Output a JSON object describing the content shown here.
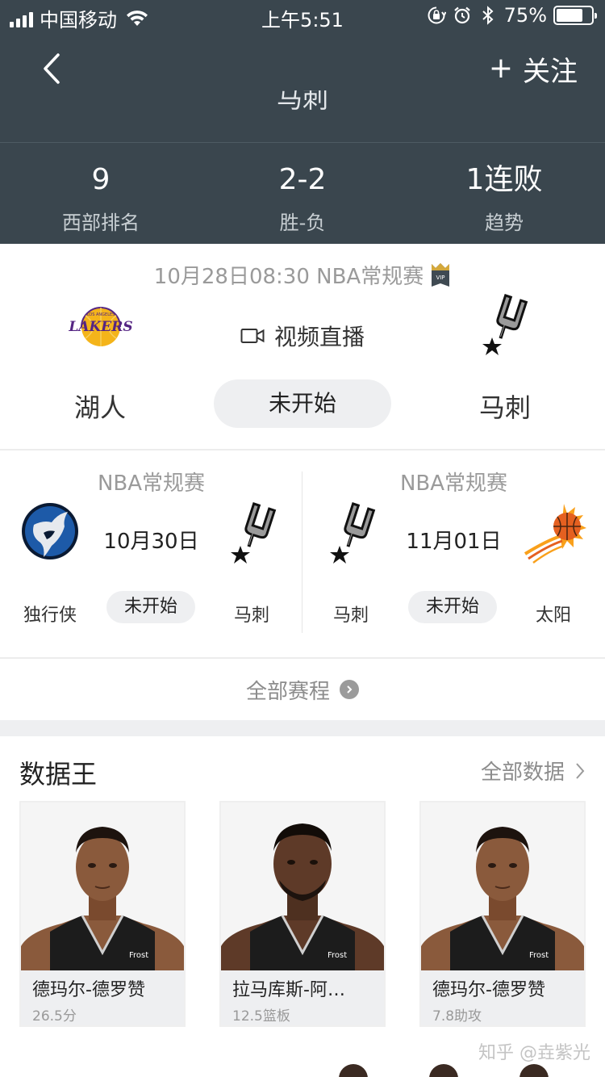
{
  "status_bar": {
    "carrier": "中国移动",
    "time": "上午5:51",
    "battery": "75%",
    "battery_level": 0.75
  },
  "header": {
    "back_icon": "chevron-left-icon",
    "follow_label": "关注",
    "follow_icon": "plus-icon",
    "team_title": "马刺",
    "background": "#3a464e"
  },
  "stats": [
    {
      "value": "9",
      "label": "西部排名"
    },
    {
      "value": "2-2",
      "label": "胜-负"
    },
    {
      "value": "1连败",
      "label": "趋势"
    }
  ],
  "next_game": {
    "info": "10月28日08:30 NBA常规赛",
    "vip_icon": "vip-crown-icon",
    "video_label": "视频直播",
    "video_icon": "video-camera-icon",
    "home_team": "湖人",
    "away_team": "马刺",
    "status": "未开始",
    "home_logo": "lakers-logo",
    "away_logo": "spurs-logo"
  },
  "schedule": [
    {
      "league": "NBA常规赛",
      "date": "10月30日",
      "home_team": "独行侠",
      "away_team": "马刺",
      "status": "未开始",
      "home_logo": "mavericks-logo",
      "away_logo": "spurs-logo"
    },
    {
      "league": "NBA常规赛",
      "date": "11月01日",
      "home_team": "马刺",
      "away_team": "太阳",
      "status": "未开始",
      "home_logo": "spurs-logo",
      "away_logo": "suns-logo"
    }
  ],
  "all_schedule_label": "全部赛程",
  "data_king": {
    "title": "数据王",
    "all_data_label": "全部数据",
    "players": [
      {
        "name": "德玛尔-德罗赞",
        "stat": "26.5分"
      },
      {
        "name": "拉马库斯-阿…",
        "stat": "12.5篮板"
      },
      {
        "name": "德玛尔-德罗赞",
        "stat": "7.8助攻"
      }
    ]
  },
  "watermark": "知乎 @垚紫光"
}
